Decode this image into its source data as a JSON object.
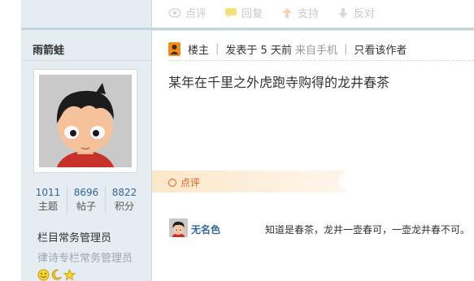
{
  "actions": [
    {
      "label": "点评",
      "icon": "eye-icon"
    },
    {
      "label": "回复",
      "icon": "speech-bubble-icon"
    },
    {
      "label": "支持",
      "icon": "arrow-up-icon"
    },
    {
      "label": "反对",
      "icon": "arrow-down-icon"
    }
  ],
  "sidebar": {
    "author": "雨箭蛙",
    "stats": [
      {
        "value": "1011",
        "label": "主题"
      },
      {
        "value": "8696",
        "label": "帖子"
      },
      {
        "value": "8822",
        "label": "积分"
      }
    ],
    "role": "栏目常务管理员",
    "subrole": "律诗专栏常务管理员"
  },
  "post": {
    "owner_label": "楼主",
    "posted": "发表于 5 天前",
    "source": "来自手机",
    "only_author": "只看该作者",
    "title": "某年在千里之外虎跑寺购得的龙井春茶"
  },
  "comments": {
    "section_label": "点评",
    "items": [
      {
        "name": "无名色",
        "text": "知道是春茶，龙井一壶春可，一壶龙井春不可。"
      }
    ]
  },
  "colors": {
    "accent_orange": "#e05a1c",
    "link_blue": "#336699",
    "sidebar_bg": "#e5edf2"
  }
}
